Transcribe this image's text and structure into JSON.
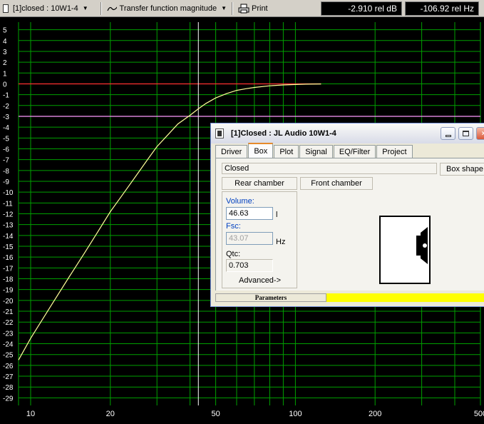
{
  "toolbar": {
    "project_select": "[1]closed : 10W1-4",
    "view_select": "Transfer function magnitude",
    "print_label": "Print",
    "readout_db": "-2.910 rel dB",
    "readout_hz": "-106.92 rel Hz"
  },
  "chart_data": {
    "type": "line",
    "title": "",
    "xlabel": "",
    "ylabel": "",
    "x_scale": "log",
    "xlim": [
      9,
      500
    ],
    "ylim": [
      -29.7,
      5.7
    ],
    "x_tick_labels": [
      "10",
      "20",
      "50",
      "100",
      "200",
      "500"
    ],
    "x_tick_values": [
      10,
      20,
      50,
      100,
      200,
      500
    ],
    "y_tick_values": [
      5,
      4,
      3,
      2,
      1,
      0,
      -1,
      -2,
      -3,
      -4,
      -5,
      -6,
      -7,
      -8,
      -9,
      -10,
      -11,
      -12,
      -13,
      -14,
      -15,
      -16,
      -17,
      -18,
      -19,
      -20,
      -21,
      -22,
      -23,
      -24,
      -25,
      -26,
      -27,
      -28,
      -29
    ],
    "grid": true,
    "series": [
      {
        "color": "#ffff99",
        "x": [
          9,
          10,
          12,
          14,
          16,
          18,
          20,
          22,
          25,
          28,
          30,
          33,
          36,
          40,
          43,
          46,
          50,
          55,
          60,
          65,
          70,
          80,
          90,
          100,
          110,
          125
        ],
        "y": [
          -25.5,
          -23.5,
          -20.4,
          -17.8,
          -15.6,
          -13.6,
          -11.8,
          -10.4,
          -8.5,
          -6.8,
          -5.8,
          -4.7,
          -3.7,
          -2.9,
          -2.3,
          -1.8,
          -1.3,
          -0.9,
          -0.6,
          -0.45,
          -0.33,
          -0.18,
          -0.1,
          -0.06,
          -0.03,
          -0.01
        ]
      }
    ],
    "reference_lines": [
      {
        "orientation": "horizontal",
        "value": 0,
        "color": "#ff3030",
        "x_end": 125
      },
      {
        "orientation": "horizontal",
        "value": -3,
        "color": "#ff99ff"
      },
      {
        "orientation": "vertical",
        "value": 43,
        "color": "#ffffff"
      }
    ],
    "grid_color": "#00a000"
  },
  "dialog": {
    "title": "[1]Closed : JL Audio 10W1-4",
    "tabs": [
      "Driver",
      "Box",
      "Plot",
      "Signal",
      "EQ/Filter",
      "Project"
    ],
    "active_tab": "Box",
    "box_type": "Closed",
    "box_shape_label": "Box shape",
    "rear_chamber_label": "Rear chamber",
    "front_chamber_label": "Front chamber",
    "volume_label": "Volume:",
    "volume_value": "46.63",
    "volume_unit": "l",
    "fsc_label": "Fsc:",
    "fsc_value": "43.07",
    "fsc_unit": "Hz",
    "qtc_label": "Qtc:",
    "qtc_value": "0.703",
    "advanced_label": "Advanced->",
    "status_label": "Parameters",
    "status_color": "#ffff00"
  }
}
